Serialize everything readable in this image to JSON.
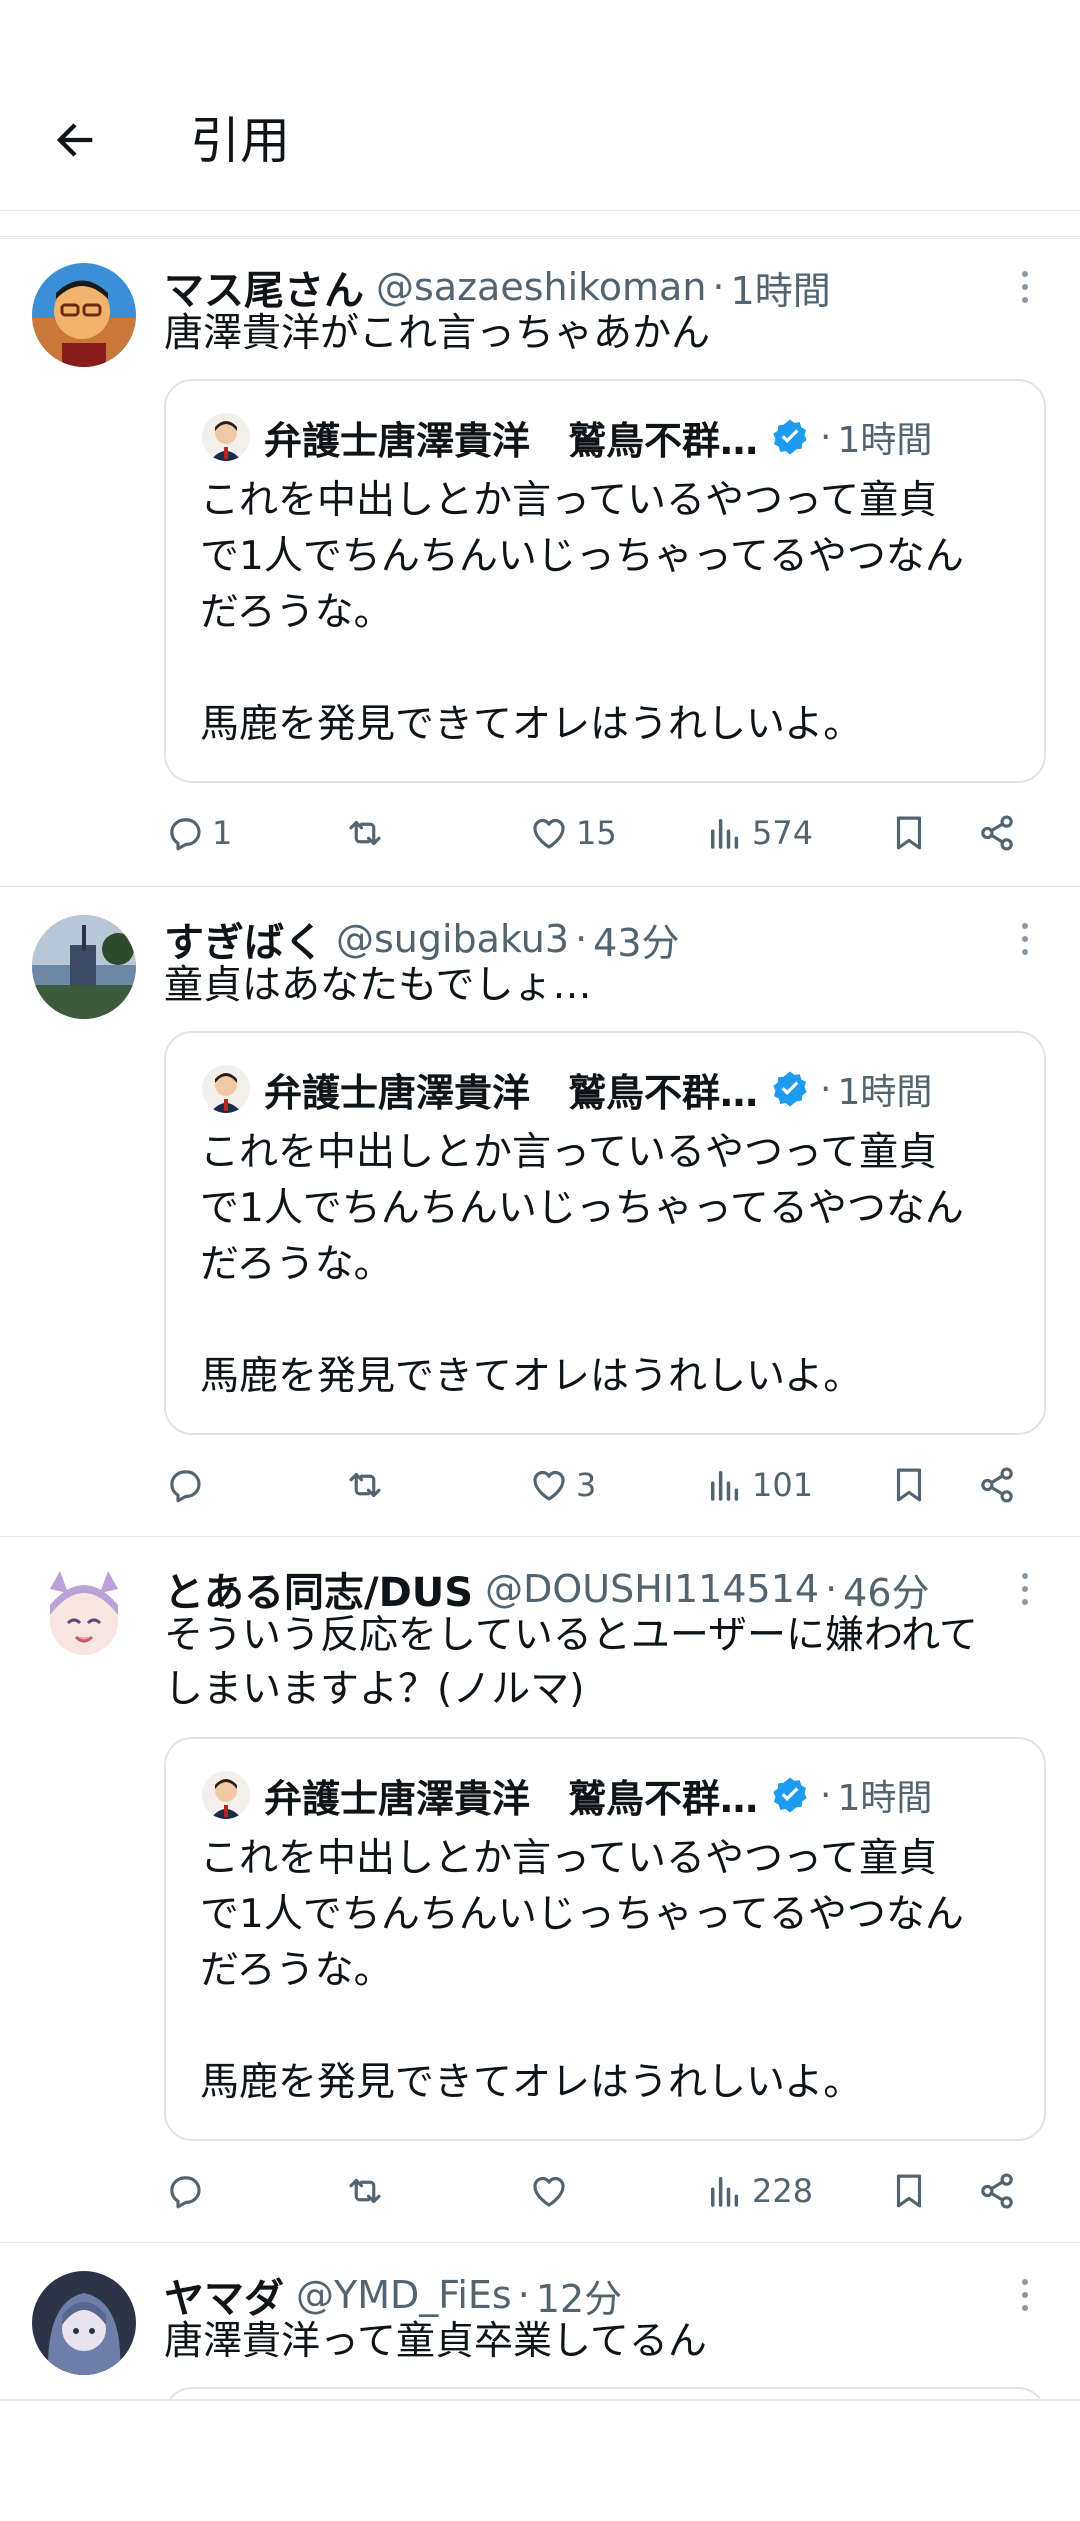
{
  "header": {
    "title": "引用"
  },
  "quoted": {
    "name": "弁護士唐澤貴洋　鷲鳥不群…",
    "time": "1時間",
    "body": "これを中出しとか言っているやつって童貞\nで1人でちんちんいじっちゃってるやつなん\nだろうな。\n\n馬鹿を発見できてオレはうれしいよ。"
  },
  "tweets": [
    {
      "name": "マス尾さん",
      "handle": "@sazaeshikoman",
      "time": "1時間",
      "text": "唐澤貴洋がこれ言っちゃあかん",
      "replies": "1",
      "likes": "15",
      "views": "574"
    },
    {
      "name": "すぎばく",
      "handle": "@sugibaku3",
      "time": "43分",
      "text": "童貞はあなたもでしょ…",
      "replies": "",
      "likes": "3",
      "views": "101"
    },
    {
      "name": "とある同志/DUS",
      "handle": "@DOUSHI114514",
      "time": "46分",
      "text": "そういう反応をしているとユーザーに嫌われて\nしまいますよ？(ノルマ)",
      "replies": "",
      "likes": "",
      "views": "228"
    },
    {
      "name": "ヤマダ",
      "handle": "@YMD_FiEs",
      "time": "12分",
      "text": "唐澤貴洋って童貞卒業してるん"
    }
  ],
  "sep": "·",
  "colors": {
    "accent": "#1d9bf0",
    "muted": "#536471",
    "border": "#e6e9eb"
  },
  "icons": [
    "back-arrow-icon",
    "more-icon",
    "verified-badge-icon",
    "reply-icon",
    "retweet-icon",
    "like-icon",
    "views-icon",
    "bookmark-icon",
    "share-icon"
  ]
}
